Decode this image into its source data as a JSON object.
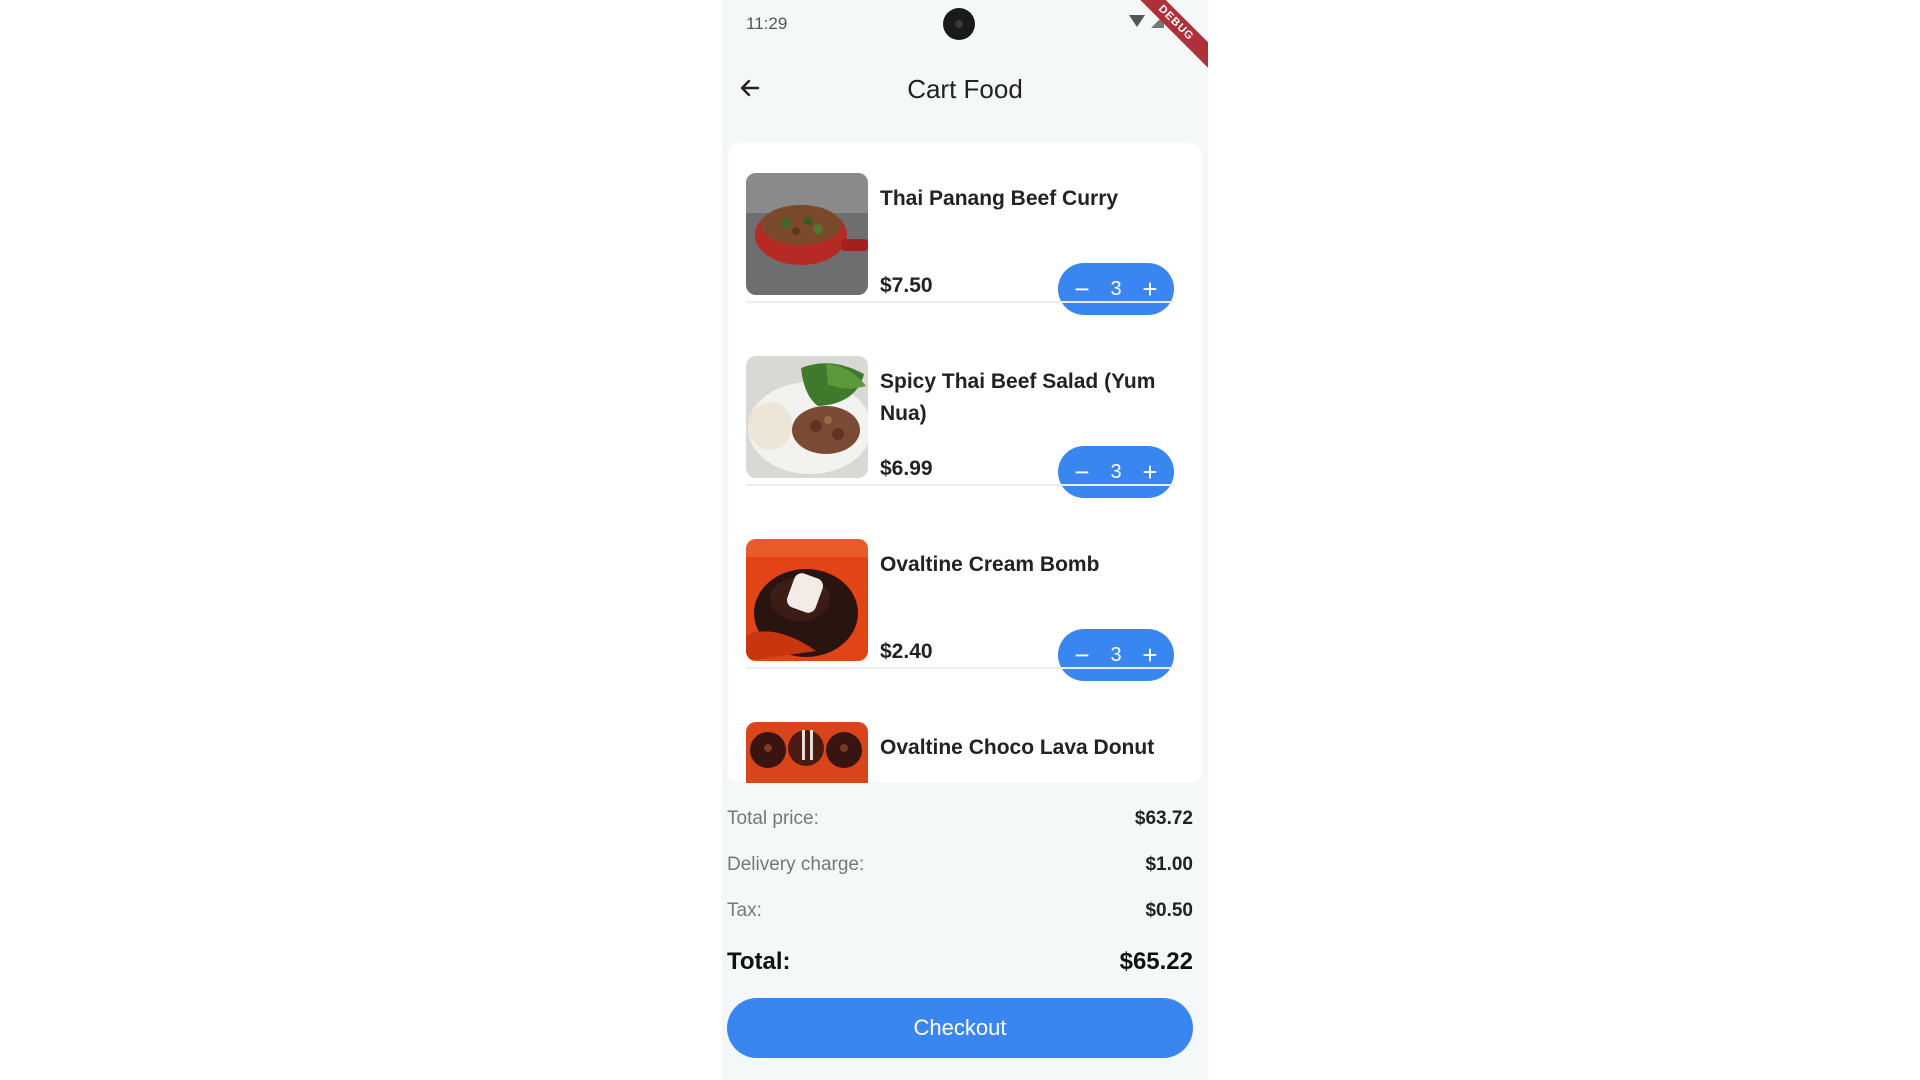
{
  "status_bar": {
    "time": "11:29",
    "debug_label": "DEBUG"
  },
  "header": {
    "title": "Cart Food"
  },
  "cart_items": [
    {
      "name": "Thai Panang Beef Curry",
      "price": "$7.50",
      "quantity": "3",
      "image": "beef-curry-photo"
    },
    {
      "name": "Spicy Thai Beef Salad (Yum Nua)",
      "price": "$6.99",
      "quantity": "3",
      "image": "beef-salad-photo"
    },
    {
      "name": "Ovaltine Cream Bomb",
      "price": "$2.40",
      "quantity": "3",
      "image": "cream-bomb-photo"
    },
    {
      "name": "Ovaltine Choco Lava Donut",
      "price": "",
      "quantity": "",
      "image": "lava-donut-photo"
    }
  ],
  "stepper": {
    "minus": "−",
    "plus": "+"
  },
  "summary": {
    "total_price_label": "Total price:",
    "total_price_value": "$63.72",
    "delivery_label": "Delivery charge:",
    "delivery_value": "$1.00",
    "tax_label": "Tax:",
    "tax_value": "$0.50",
    "grand_total_label": "Total:",
    "grand_total_value": "$65.22"
  },
  "checkout": {
    "label": "Checkout"
  },
  "colors": {
    "accent": "#3a86f0",
    "background": "#f4f8f8",
    "card": "#ffffff"
  }
}
